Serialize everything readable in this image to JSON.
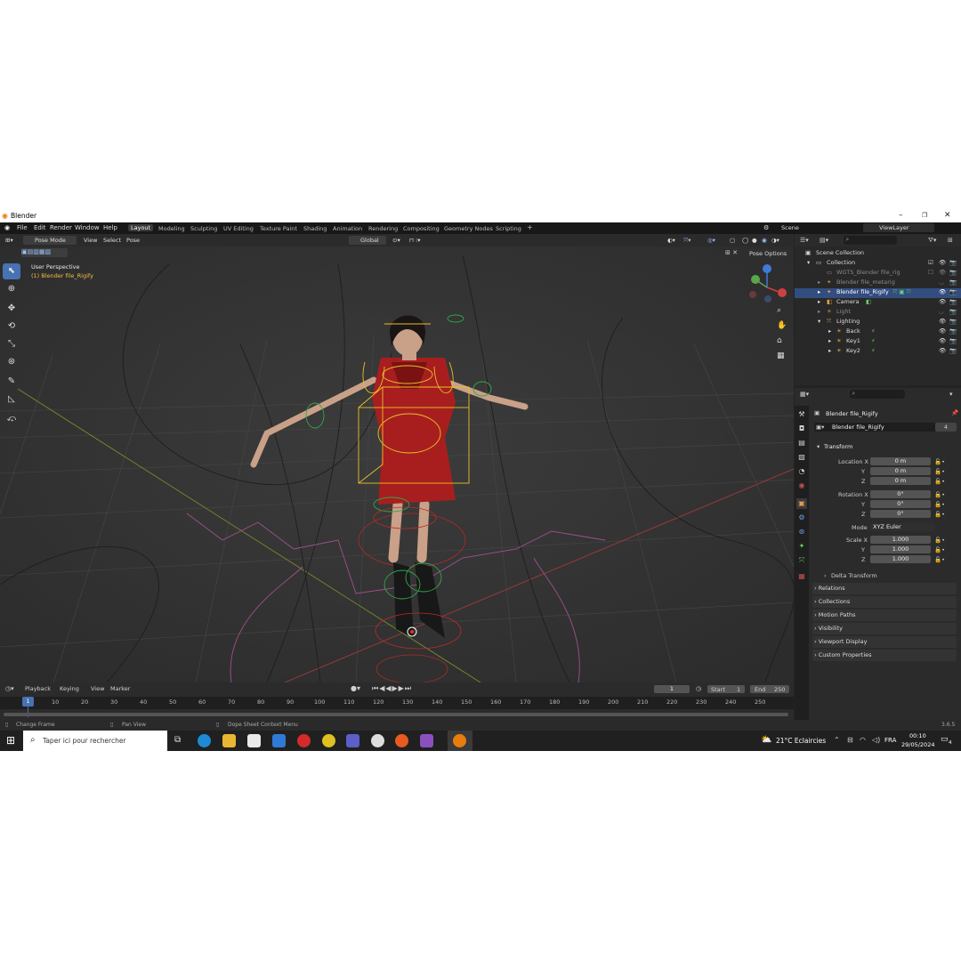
{
  "window": {
    "title": "Blender"
  },
  "menu": {
    "items": [
      "File",
      "Edit",
      "Render",
      "Window",
      "Help"
    ]
  },
  "workspaces": [
    "Layout",
    "Modeling",
    "Sculpting",
    "UV Editing",
    "Texture Paint",
    "Shading",
    "Animation",
    "Rendering",
    "Compositing",
    "Geometry Nodes",
    "Scripting"
  ],
  "active_workspace": "Layout",
  "scene": {
    "name": "Scene",
    "view_layer": "ViewLayer"
  },
  "viewport": {
    "mode": "Pose Mode",
    "menus": [
      "View",
      "Select",
      "Pose"
    ],
    "orientation": "Global",
    "pose_options": "Pose Options",
    "perspective_label": "User Perspective",
    "object_label": "(1) Blender file_Rigify"
  },
  "outliner": {
    "root": "Scene Collection",
    "items": [
      {
        "name": "Collection",
        "level": 1
      },
      {
        "name": "WGTS_Blender file_rig",
        "level": 2,
        "dim": true
      },
      {
        "name": "Blender file_metarig",
        "level": 2,
        "dim": true
      },
      {
        "name": "Blender file_Rigify",
        "level": 2,
        "selected": true
      },
      {
        "name": "Camera",
        "level": 2
      },
      {
        "name": "Light",
        "level": 2,
        "dim": true
      },
      {
        "name": "Lighting",
        "level": 2
      },
      {
        "name": "Back",
        "level": 3
      },
      {
        "name": "Key1",
        "level": 3
      },
      {
        "name": "Key2",
        "level": 3
      }
    ]
  },
  "properties": {
    "object_name": "Blender file_Rigify",
    "data_name": "Blender file_Rigify",
    "users": "4",
    "transform_label": "Transform",
    "location": {
      "label": "Location X",
      "x": "0 m",
      "y": "0 m",
      "z": "0 m"
    },
    "rotation": {
      "label": "Rotation X",
      "x": "0°",
      "y": "0°",
      "z": "0°"
    },
    "mode_label": "Mode",
    "mode_value": "XYZ Euler",
    "scale": {
      "label": "Scale X",
      "x": "1.000",
      "y": "1.000",
      "z": "1.000"
    },
    "axis_y": "Y",
    "axis_z": "Z",
    "panels": [
      "Delta Transform",
      "Relations",
      "Collections",
      "Motion Paths",
      "Visibility",
      "Viewport Display",
      "Custom Properties"
    ]
  },
  "timeline": {
    "menus": [
      "Playback",
      "Keying",
      "View",
      "Marker"
    ],
    "current_frame": "1",
    "start_label": "Start",
    "start": "1",
    "end_label": "End",
    "end": "250",
    "ticks": [
      "1",
      "10",
      "20",
      "30",
      "40",
      "50",
      "60",
      "70",
      "80",
      "90",
      "100",
      "110",
      "120",
      "130",
      "140",
      "150",
      "160",
      "170",
      "180",
      "190",
      "200",
      "210",
      "220",
      "230",
      "240",
      "250"
    ]
  },
  "status": {
    "left": "Change Frame",
    "middle": "Pan View",
    "context": "Dope Sheet Context Menu",
    "version": "3.6.5"
  },
  "taskbar": {
    "search_placeholder": "Taper ici pour rechercher",
    "weather": "21°C  Eclaircies",
    "lang": "FRA",
    "time": "00:10",
    "date": "29/05/2024",
    "notifications": "4"
  },
  "colors": {
    "accent": "#4772b3",
    "selected_row": "#334d80",
    "bone_yellow": "#e8c02a",
    "dress": "#b02020"
  }
}
